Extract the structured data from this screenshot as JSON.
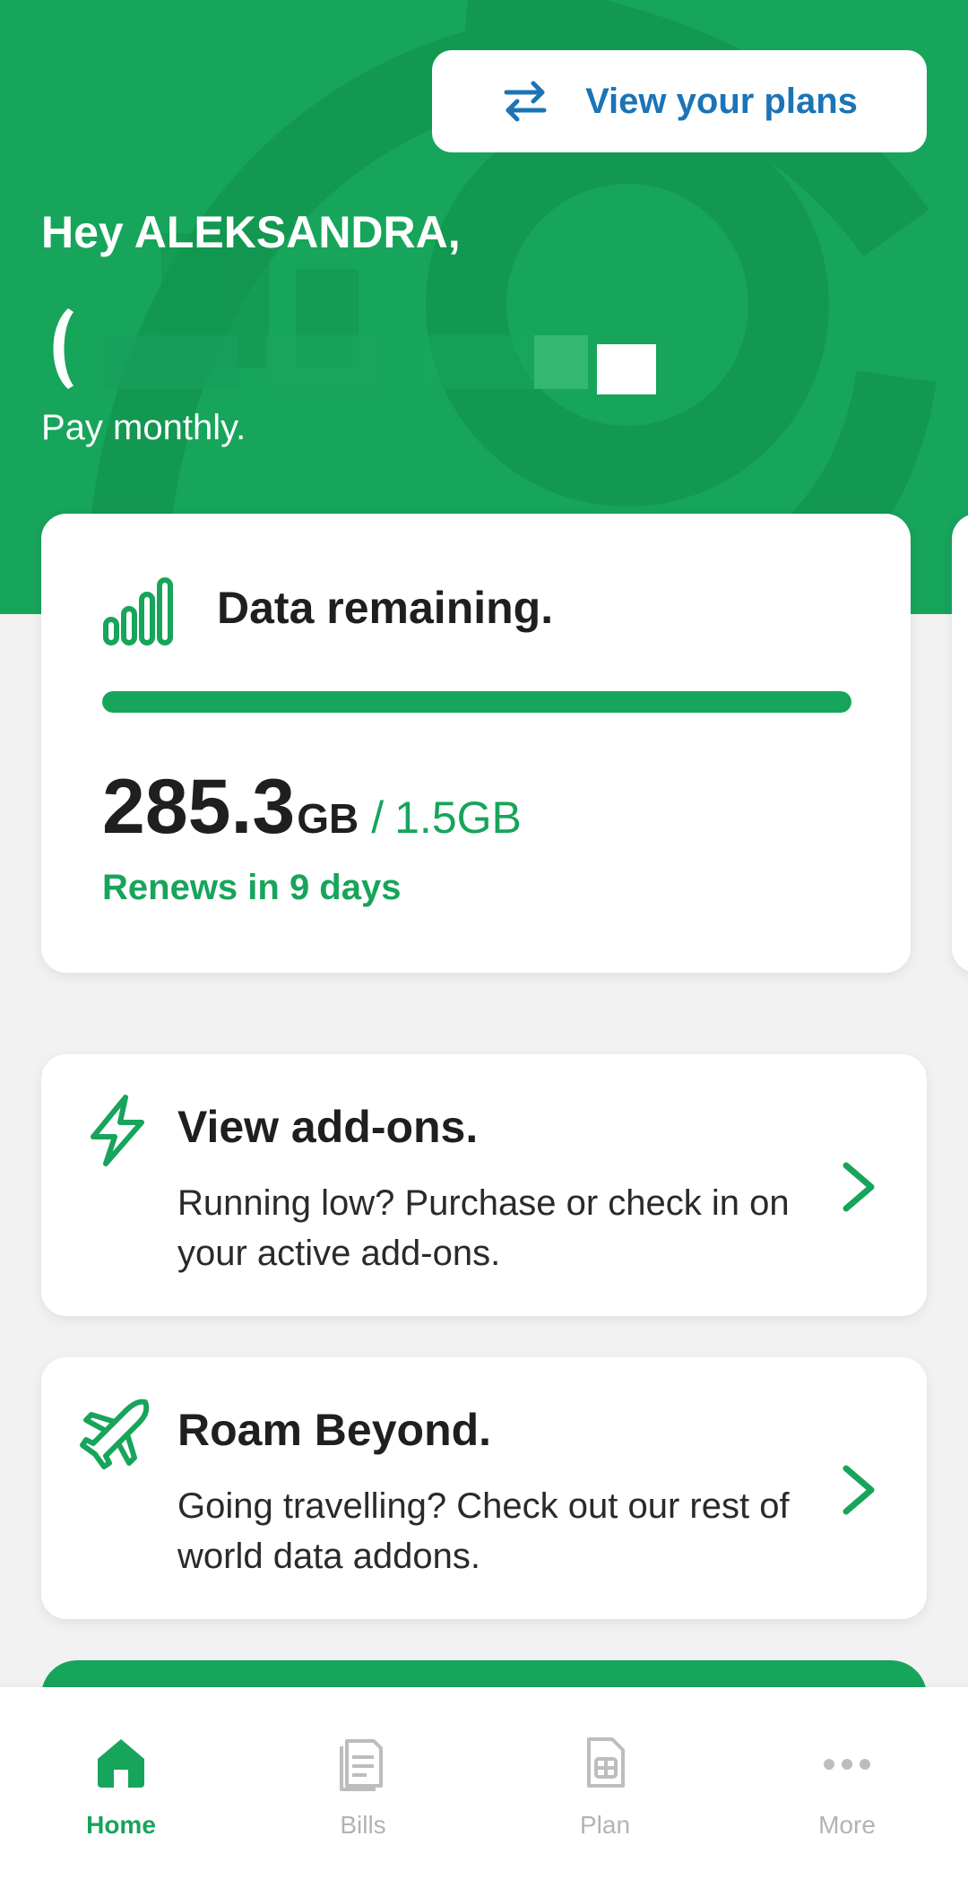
{
  "header": {
    "plans_button_label": "View your plans",
    "greeting": "Hey ALEKSANDRA,",
    "plan_type": "Pay monthly."
  },
  "data_card": {
    "title": "Data remaining.",
    "used_value": "285.3",
    "used_unit": "GB",
    "separator": "/",
    "total": "1.5GB",
    "renews": "Renews in 9 days",
    "progress_fraction": 1.0
  },
  "actions": [
    {
      "title": "View add-ons.",
      "description": "Running low? Purchase or check in on your active add-ons.",
      "icon": "lightning-icon"
    },
    {
      "title": "Roam Beyond.",
      "description": "Going travelling? Check out our rest of world data addons.",
      "icon": "airplane-icon"
    }
  ],
  "nav": {
    "items": [
      {
        "label": "Home",
        "icon": "home-icon",
        "active": true
      },
      {
        "label": "Bills",
        "icon": "bills-icon",
        "active": false
      },
      {
        "label": "Plan",
        "icon": "sim-icon",
        "active": false
      },
      {
        "label": "More",
        "icon": "more-icon",
        "active": false
      }
    ]
  },
  "colors": {
    "brand_green": "#17a45b",
    "link_blue": "#1b74b5",
    "background": "#f2f2f2",
    "text_dark": "#1f1f1f",
    "inactive_gray": "#b3b3b3"
  }
}
